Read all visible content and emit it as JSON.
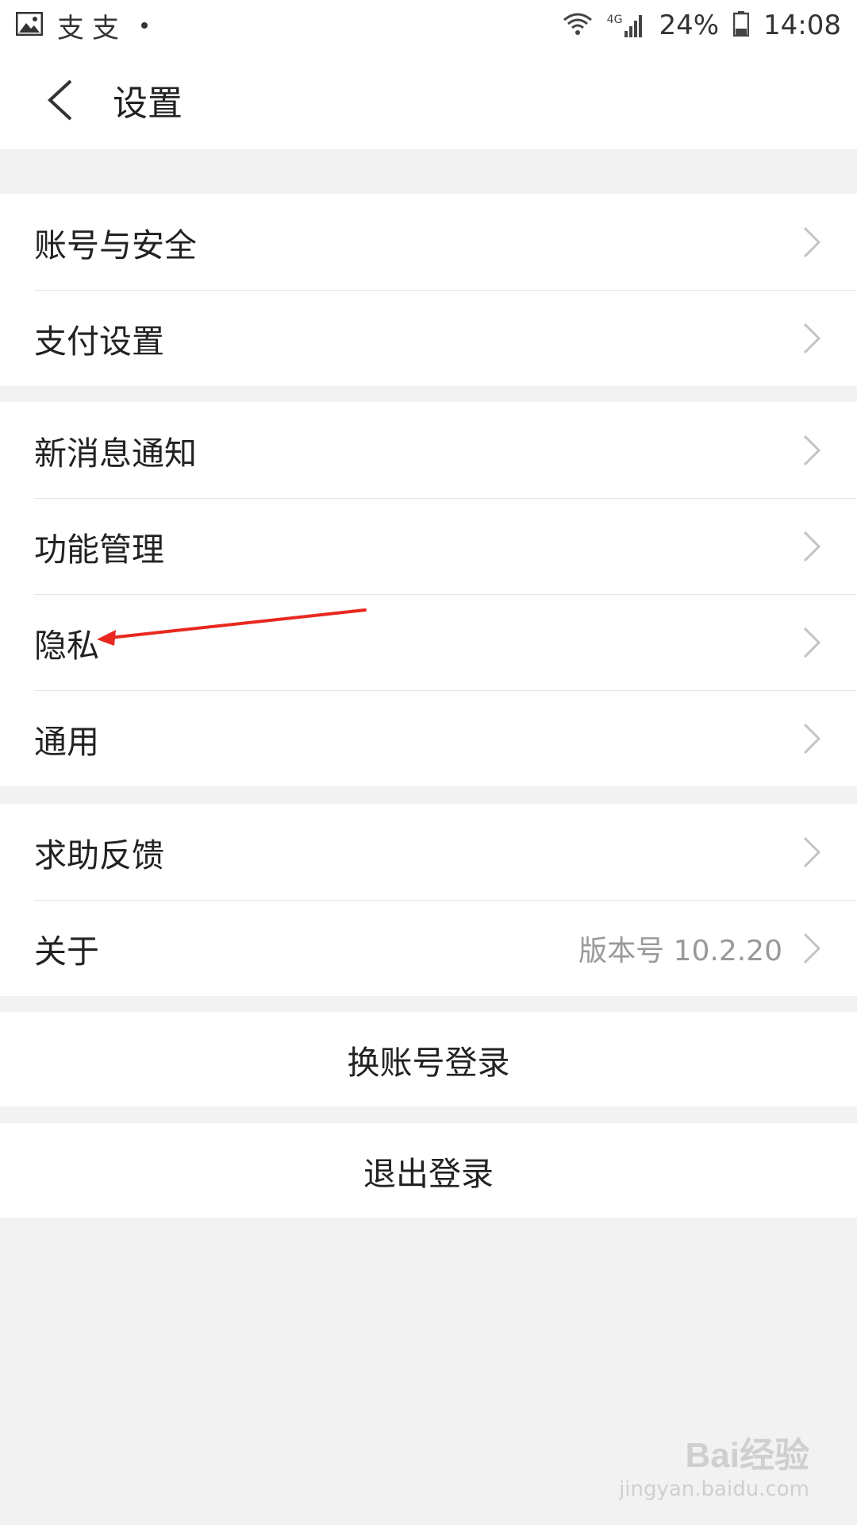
{
  "status_bar": {
    "carrier": "支支",
    "battery": "24%",
    "time": "14:08",
    "network": "4G"
  },
  "header": {
    "title": "设置"
  },
  "groups": [
    {
      "items": [
        {
          "label": "账号与安全"
        },
        {
          "label": "支付设置"
        }
      ]
    },
    {
      "items": [
        {
          "label": "新消息通知"
        },
        {
          "label": "功能管理"
        },
        {
          "label": "隐私"
        },
        {
          "label": "通用"
        }
      ]
    },
    {
      "items": [
        {
          "label": "求助反馈"
        },
        {
          "label": "关于",
          "value": "版本号 10.2.20"
        }
      ]
    }
  ],
  "actions": {
    "switch_account": "换账号登录",
    "logout": "退出登录"
  },
  "annotation": {
    "arrow_color": "#e8281f"
  },
  "watermark": {
    "logo": "Bai经验",
    "url": "jingyan.baidu.com"
  }
}
